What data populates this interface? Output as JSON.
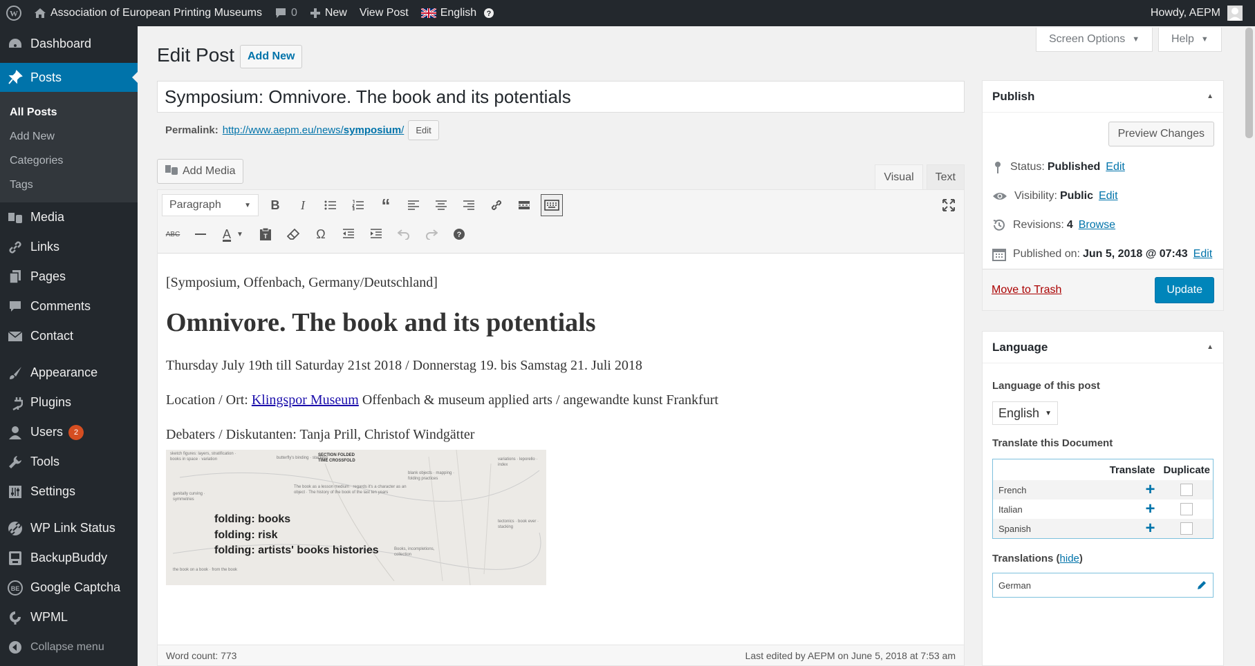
{
  "admin_bar": {
    "site_name": "Association of European Printing Museums",
    "comments_count": "0",
    "new_label": "New",
    "view_post_label": "View Post",
    "language_label": "English",
    "greeting": "Howdy, AEPM"
  },
  "sidebar": {
    "dashboard": "Dashboard",
    "posts": "Posts",
    "posts_sub": [
      "All Posts",
      "Add New",
      "Categories",
      "Tags"
    ],
    "media": "Media",
    "links": "Links",
    "pages": "Pages",
    "comments": "Comments",
    "contact": "Contact",
    "appearance": "Appearance",
    "plugins": "Plugins",
    "users": "Users",
    "users_badge": "2",
    "tools": "Tools",
    "settings": "Settings",
    "wp_link_status": "WP Link Status",
    "backupbuddy": "BackupBuddy",
    "google_captcha": "Google Captcha",
    "wpml": "WPML",
    "collapse": "Collapse menu"
  },
  "header": {
    "screen_options": "Screen Options",
    "help": "Help",
    "title": "Edit Post",
    "add_new": "Add New"
  },
  "post": {
    "title": "Symposium: Omnivore. The book and its potentials",
    "permalink_label": "Permalink:",
    "permalink_base": "http://www.aepm.eu/news/",
    "permalink_slug": "symposium",
    "permalink_end": "/",
    "permalink_edit": "Edit"
  },
  "editor": {
    "add_media": "Add Media",
    "tab_visual": "Visual",
    "tab_text": "Text",
    "format_select": "Paragraph",
    "content": {
      "line1": "[Symposium, Offenbach, Germany/Deutschland]",
      "heading": "Omnivore. The book and its potentials",
      "dates": "Thursday July 19th till Saturday 21st 2018 / Donnerstag 19. bis Samstag 21. Juli 2018",
      "location_prefix": "Location / Ort: ",
      "location_link": "Klingspor Museum",
      "location_suffix": " Offenbach & museum applied arts / angewandte kunst Frankfurt",
      "debaters": "Debaters / Diskutanten: Tanja Prill, Christof Windgätter",
      "image_text": [
        "folding: books",
        "folding: risk",
        "folding: artists' books histories"
      ]
    },
    "word_count": "Word count: 773",
    "last_edited": "Last edited by AEPM on June 5, 2018 at 7:53 am"
  },
  "publish": {
    "title": "Publish",
    "preview": "Preview Changes",
    "status_label": "Status:",
    "status_value": "Published",
    "visibility_label": "Visibility:",
    "visibility_value": "Public",
    "revisions_label": "Revisions:",
    "revisions_value": "4",
    "browse": "Browse",
    "published_label": "Published on:",
    "published_value": "Jun 5, 2018 @ 07:43",
    "edit": "Edit",
    "trash": "Move to Trash",
    "update": "Update"
  },
  "language": {
    "title": "Language",
    "post_language_label": "Language of this post",
    "selected": "English",
    "translate_label": "Translate this Document",
    "col_translate": "Translate",
    "col_duplicate": "Duplicate",
    "rows": [
      "French",
      "Italian",
      "Spanish"
    ],
    "translations_label": "Translations",
    "hide": "hide",
    "existing": "German"
  }
}
